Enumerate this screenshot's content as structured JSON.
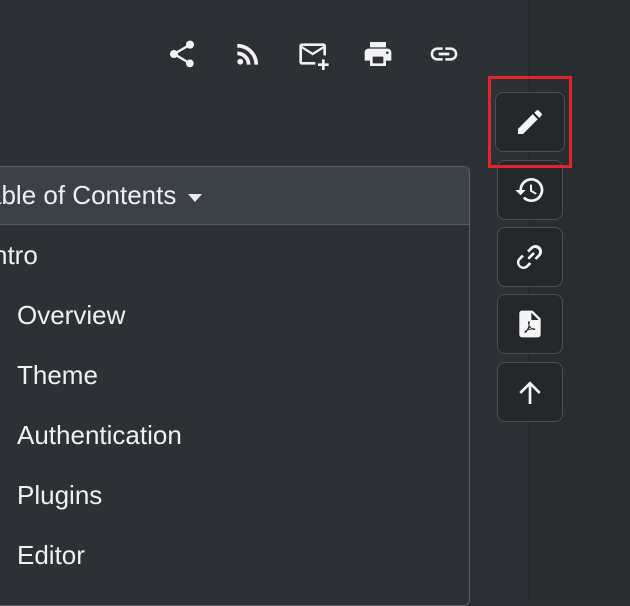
{
  "toolbar": {
    "actions": [
      {
        "name": "share-button",
        "icon": "share-icon"
      },
      {
        "name": "rss-button",
        "icon": "rss-icon"
      },
      {
        "name": "email-button",
        "icon": "email-add-icon"
      },
      {
        "name": "print-button",
        "icon": "printer-icon"
      },
      {
        "name": "link-button",
        "icon": "link-icon"
      }
    ]
  },
  "toc": {
    "title": "able of Contents",
    "items": [
      {
        "label": "ntro",
        "level": 0
      },
      {
        "label": "Overview",
        "level": 1
      },
      {
        "label": "Theme",
        "level": 1
      },
      {
        "label": "Authentication",
        "level": 1
      },
      {
        "label": "Plugins",
        "level": 1
      },
      {
        "label": "Editor",
        "level": 1
      }
    ]
  },
  "tools": [
    {
      "icon": "pencil-icon",
      "name": "edit-page-button"
    },
    {
      "icon": "history-icon",
      "name": "history-button"
    },
    {
      "icon": "link-icon",
      "name": "permalink-button"
    },
    {
      "icon": "pdf-icon",
      "name": "pdf-export-button"
    },
    {
      "icon": "arrow-up-icon",
      "name": "scroll-top-button"
    }
  ],
  "colors": {
    "background": "#2d3135",
    "panel_header": "#3b4147",
    "tool_background": "#25282b",
    "highlight": "#e2252b",
    "text": "#eef0f2"
  }
}
